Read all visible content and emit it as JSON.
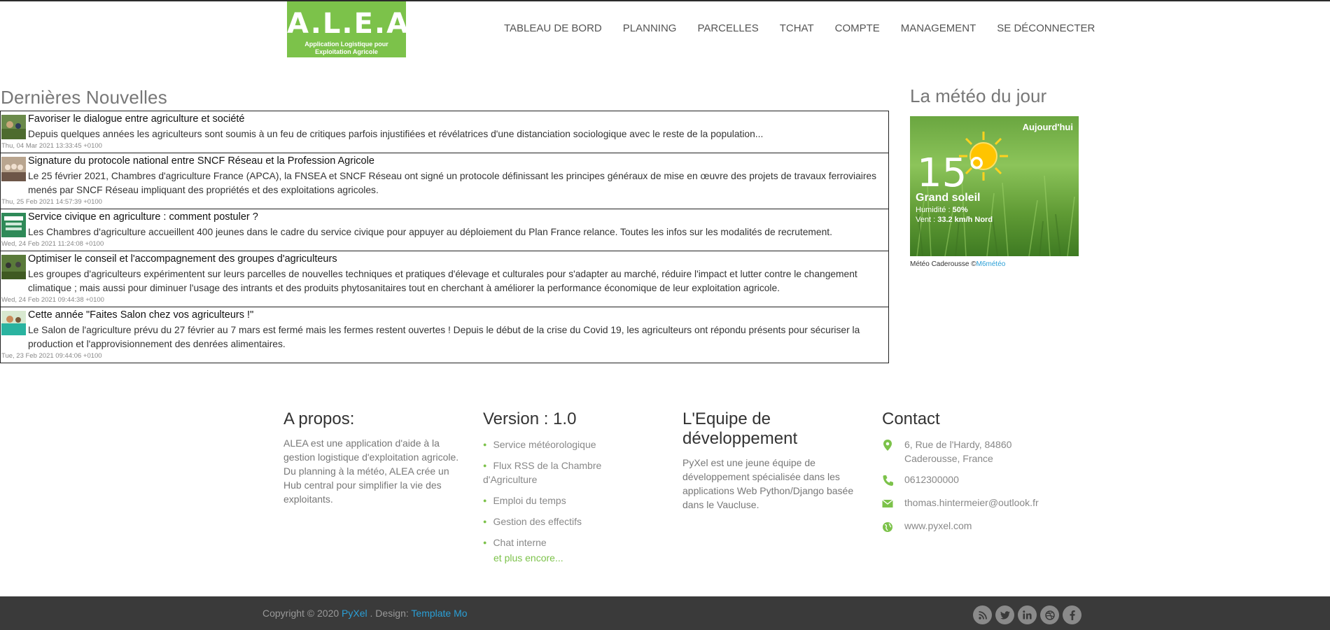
{
  "logo": {
    "title": "A.L.E.A",
    "subtitle_line1": "Application Logistique pour",
    "subtitle_line2": "Exploitation Agricole"
  },
  "nav": [
    "TABLEAU DE BORD",
    "PLANNING",
    "PARCELLES",
    "TCHAT",
    "COMPTE",
    "MANAGEMENT",
    "SE DÉCONNECTER"
  ],
  "news": {
    "title": "Dernières Nouvelles",
    "items": [
      {
        "headline": "Favoriser le dialogue entre agriculture et société",
        "desc": "Depuis quelques années les agriculteurs sont soumis à un feu de critiques parfois injustifiées et révélatrices d'une distanciation sociologique avec le reste de la population...",
        "date": "Thu, 04 Mar 2021 13:33:45 +0100"
      },
      {
        "headline": "Signature du protocole national entre SNCF Réseau et la Profession Agricole",
        "desc": "Le 25 février 2021, Chambres d'agriculture France (APCA), la FNSEA et SNCF Réseau ont signé un protocole définissant les principes généraux de mise en œuvre des projets de travaux ferroviaires menés par SNCF Réseau impliquant des propriétés et des exploitations agricoles.",
        "date": "Thu, 25 Feb 2021 14:57:39 +0100"
      },
      {
        "headline": "Service civique en agriculture : comment postuler ?",
        "desc": "Les Chambres d'agriculture accueillent 400 jeunes dans le cadre du service civique pour appuyer au déploiement du Plan France relance. Toutes les infos sur les modalités de recrutement.",
        "date": "Wed, 24 Feb 2021 11:24:08 +0100"
      },
      {
        "headline": "Optimiser le conseil et l'accompagnement des groupes d'agriculteurs",
        "desc": "Les groupes d'agriculteurs expérimentent sur leurs parcelles de nouvelles techniques et pratiques d'élevage et culturales pour s'adapter au marché, réduire l'impact et lutter contre le changement climatique ; mais aussi pour diminuer l'usage des intrants et des produits phytosanitaires tout en cherchant à améliorer la performance économique de leur exploitation agricole.",
        "date": "Wed, 24 Feb 2021 09:44:38 +0100"
      },
      {
        "headline": "Cette année \"Faites Salon chez vos agriculteurs !\"",
        "desc": "Le Salon de l'agriculture prévu du 27 février au 7 mars est fermé mais les fermes restent ouvertes ! Depuis le début de la crise du Covid 19, les agriculteurs ont répondu présents pour sécuriser la production et l'approvisionnement des denrées alimentaires.",
        "date": "Tue, 23 Feb 2021 09:44:06 +0100"
      }
    ]
  },
  "weather": {
    "title": "La météo du jour",
    "today": "Aujourd'hui",
    "temp": "15°",
    "condition": "Grand soleil",
    "humidity_label": "Humidité : ",
    "humidity": "50%",
    "wind_label": "Vent : ",
    "wind": "33.2 km/h Nord",
    "credit": "Météo Caderousse ©",
    "credit_link": "M6météo"
  },
  "footer": {
    "about_title": "A propos:",
    "about_text": "ALEA est une application d'aide à la gestion logistique d'exploitation agricole. Du planning à la météo, ALEA crée un Hub central pour simplifier la vie des exploitants.",
    "version_title": "Version : 1.0",
    "features": [
      "Service météorologique",
      "Flux RSS de la Chambre d'Agriculture",
      "Emploi du temps",
      "Gestion des effectifs",
      "Chat interne"
    ],
    "more": "et plus encore...",
    "team_title": "L'Equipe de développement",
    "team_text": "PyXel est une jeune équipe de développement spécialisée dans les applications Web Python/Django basée dans le Vaucluse.",
    "contact_title": "Contact",
    "address": "6, Rue de l'Hardy, 84860 Caderousse, France",
    "phone": "0612300000",
    "email": "thomas.hintermeier@outlook.fr",
    "website": "www.pyxel.com"
  },
  "bottom": {
    "copyright": "Copyright © 2020 ",
    "company": "PyXel",
    "design_label": " . Design: ",
    "design_link": "Template Mo",
    "social_icons": [
      "rss-icon",
      "twitter-icon",
      "linkedin-icon",
      "dribbble-icon",
      "facebook-icon"
    ]
  },
  "colors": {
    "accent": "#7cc24a",
    "link": "#2a9fd6",
    "bottom_bar": "#3a3a3a"
  }
}
